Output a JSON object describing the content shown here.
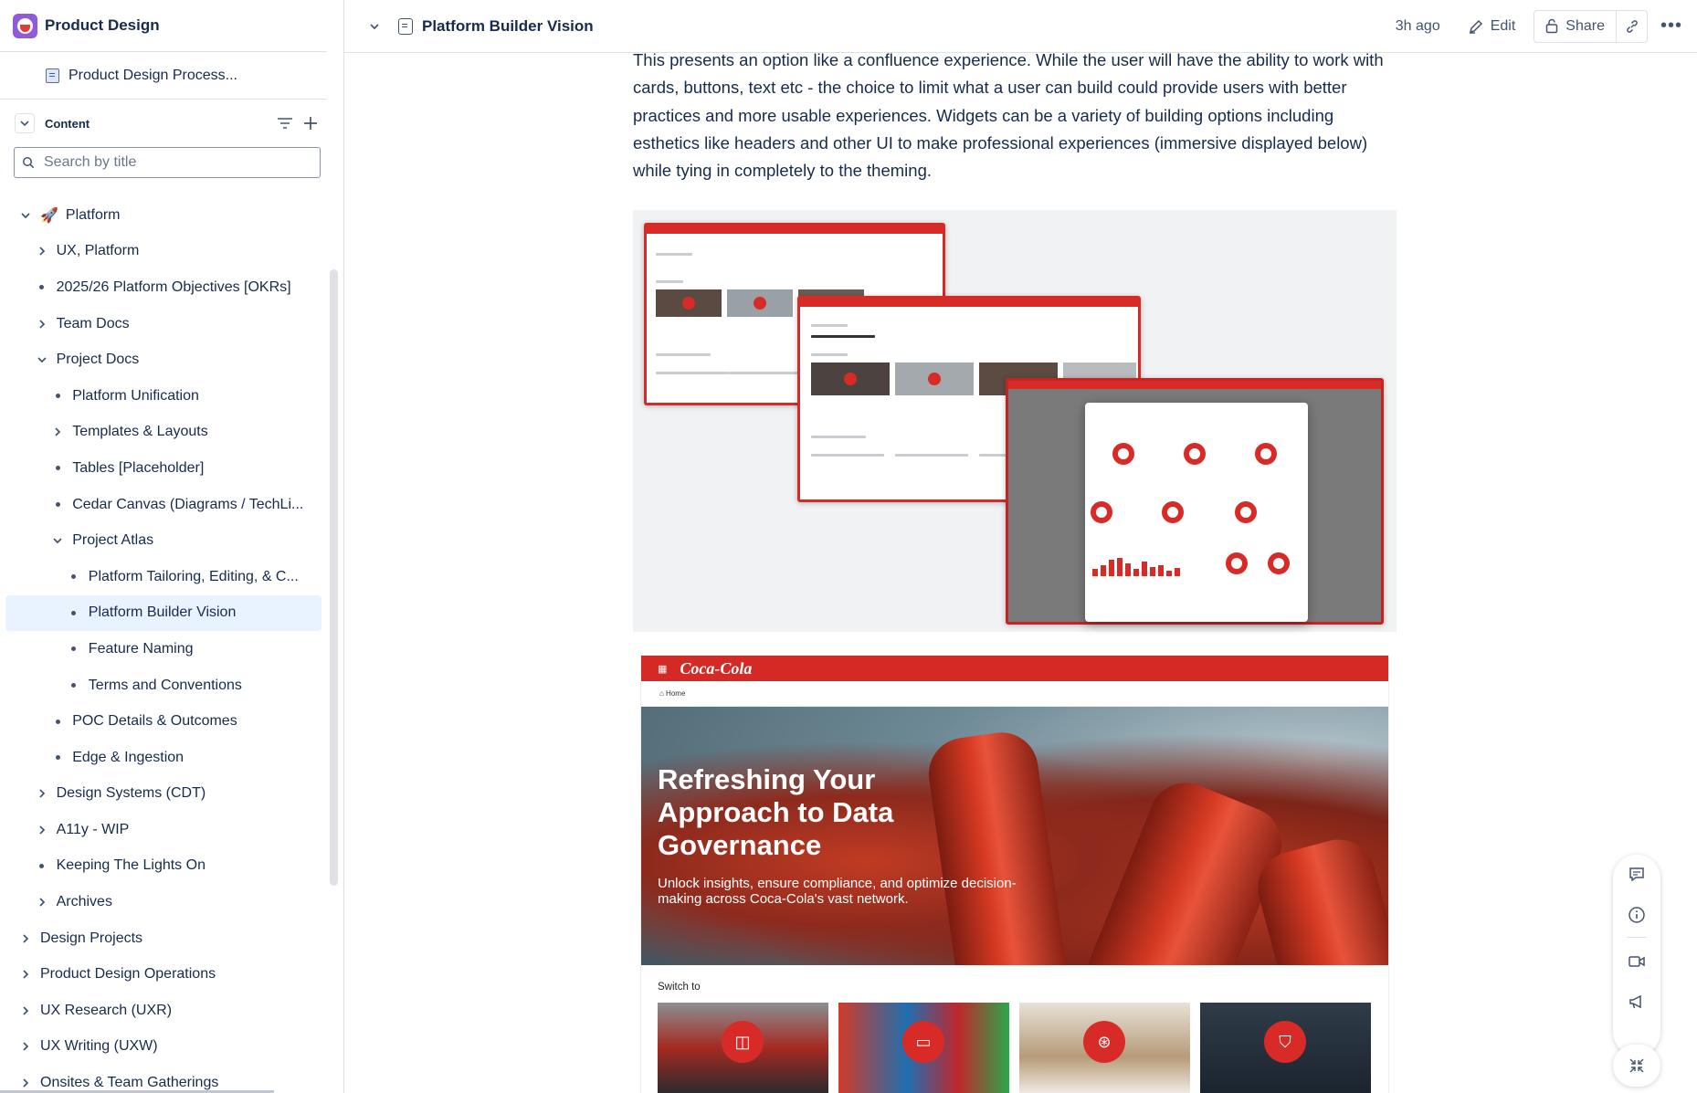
{
  "space": {
    "title": "Product Design"
  },
  "pinned": {
    "label": "Product Design Process..."
  },
  "content": {
    "label": "Content"
  },
  "search": {
    "placeholder": "Search by title"
  },
  "tree": [
    {
      "label": "Platform",
      "level": 0,
      "toggle": "open",
      "emoji": "🚀"
    },
    {
      "label": "UX, Platform",
      "level": 1,
      "toggle": "closed"
    },
    {
      "label": "2025/26 Platform Objectives [OKRs]",
      "level": 1,
      "toggle": "dot"
    },
    {
      "label": "Team Docs",
      "level": 1,
      "toggle": "closed"
    },
    {
      "label": "Project Docs",
      "level": 1,
      "toggle": "open"
    },
    {
      "label": "Platform Unification",
      "level": 2,
      "toggle": "dot"
    },
    {
      "label": "Templates & Layouts",
      "level": 2,
      "toggle": "closed"
    },
    {
      "label": "Tables [Placeholder]",
      "level": 2,
      "toggle": "dot"
    },
    {
      "label": "Cedar Canvas (Diagrams / TechLi...",
      "level": 2,
      "toggle": "dot"
    },
    {
      "label": "Project Atlas",
      "level": 2,
      "toggle": "open"
    },
    {
      "label": "Platform Tailoring, Editing, & C...",
      "level": 3,
      "toggle": "dot"
    },
    {
      "label": "Platform Builder Vision",
      "level": 3,
      "toggle": "dot",
      "selected": true
    },
    {
      "label": "Feature Naming",
      "level": 3,
      "toggle": "dot"
    },
    {
      "label": "Terms and Conventions",
      "level": 3,
      "toggle": "dot"
    },
    {
      "label": "POC Details & Outcomes",
      "level": 2,
      "toggle": "dot"
    },
    {
      "label": "Edge & Ingestion",
      "level": 2,
      "toggle": "dot"
    },
    {
      "label": "Design Systems (CDT)",
      "level": 1,
      "toggle": "closed"
    },
    {
      "label": "A11y - WIP",
      "level": 1,
      "toggle": "closed"
    },
    {
      "label": "Keeping The Lights On",
      "level": 1,
      "toggle": "dot"
    },
    {
      "label": "Archives",
      "level": 1,
      "toggle": "closed"
    },
    {
      "label": "Design Projects",
      "level": 0,
      "toggle": "closed"
    },
    {
      "label": "Product Design Operations",
      "level": 0,
      "toggle": "closed"
    },
    {
      "label": "UX Research (UXR)",
      "level": 0,
      "toggle": "closed"
    },
    {
      "label": "UX Writing (UXW)",
      "level": 0,
      "toggle": "closed"
    },
    {
      "label": "Onsites & Team Gatherings",
      "level": 0,
      "toggle": "closed"
    }
  ],
  "topbar": {
    "title": "Platform Builder Vision",
    "time": "3h ago",
    "edit": "Edit",
    "share": "Share"
  },
  "article": {
    "paragraph": "This presents an option like a confluence experience. While the user will have the ability to work with cards, buttons, text etc - the choice to limit what a user can build could provide users with better practices and more usable experiences. Widgets can be a variety of building options including esthetics like headers and other UI to make professional experiences (immersive displayed below) while tying in completely to the theming."
  },
  "screenshot2": {
    "logo": "Coca-Cola",
    "breadcrumb": "⌂ Home",
    "hero_title": "Refreshing Your Approach to Data Governance",
    "hero_sub": "Unlock insights, ensure compliance, and optimize decision-making across Coca-Cola's vast network.",
    "switch_label": "Switch to"
  },
  "colors": {
    "accent": "#d82a26",
    "selection": "#e9f2ff",
    "text": "#172b4d"
  }
}
